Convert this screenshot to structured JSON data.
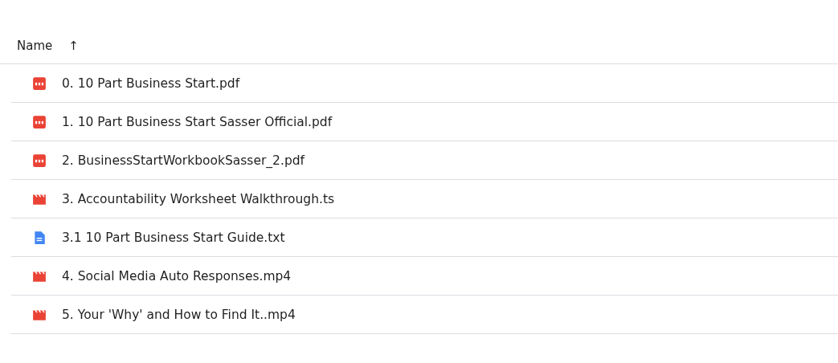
{
  "header": {
    "name_column": "Name",
    "sort_arrow": "↑"
  },
  "files": [
    {
      "kind": "pdf",
      "name": "0. 10 Part Business Start.pdf"
    },
    {
      "kind": "pdf",
      "name": "1. 10 Part Business Start Sasser Official.pdf"
    },
    {
      "kind": "pdf",
      "name": "2. BusinessStartWorkbookSasser_2.pdf"
    },
    {
      "kind": "video",
      "name": "3. Accountability Worksheet Walkthrough.ts"
    },
    {
      "kind": "doc",
      "name": "3.1 10 Part Business Start Guide.txt"
    },
    {
      "kind": "video",
      "name": "4. Social Media Auto Responses.mp4"
    },
    {
      "kind": "video",
      "name": "5. Your 'Why' and How to Find It..mp4"
    }
  ]
}
